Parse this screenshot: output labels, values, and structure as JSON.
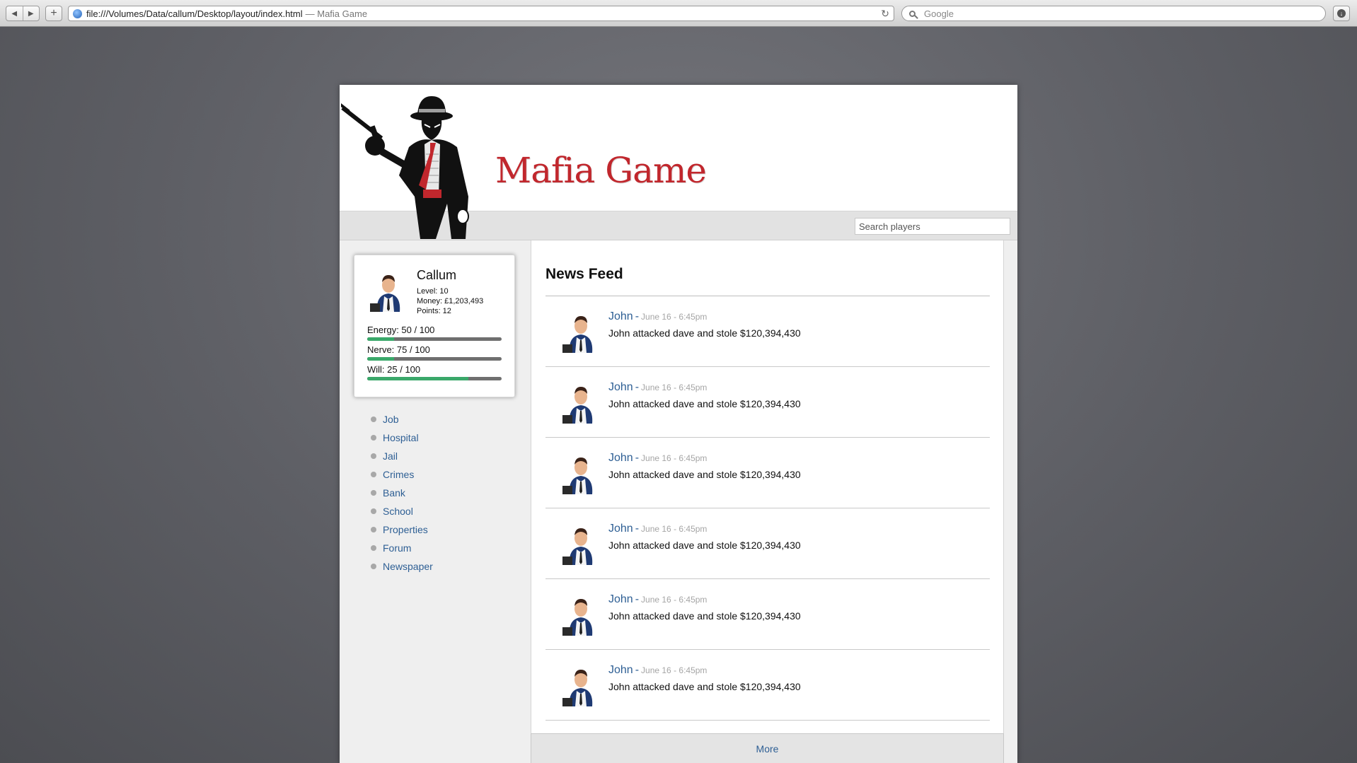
{
  "browser": {
    "url": "file:///Volumes/Data/callum/Desktop/layout/index.html",
    "title_suffix": "— Mafia Game",
    "search_placeholder": "Google"
  },
  "site": {
    "title": "Mafia Game",
    "search_placeholder": "Search players",
    "brand_color": "#c1272d",
    "link_color": "#2e5f94"
  },
  "profile": {
    "name": "Callum",
    "level": "Level: 10",
    "money": "Money: £1,203,493",
    "points": "Points: 12",
    "stats": [
      {
        "label": "Energy: 50 / 100",
        "fill": 0.2
      },
      {
        "label": "Nerve: 75 / 100",
        "fill": 0.2
      },
      {
        "label": "Will: 25 / 100",
        "fill": 0.75
      }
    ]
  },
  "nav": {
    "items": [
      "Job",
      "Hospital",
      "Jail",
      "Crimes",
      "Bank",
      "School",
      "Properties",
      "Forum",
      "Newspaper"
    ]
  },
  "feed": {
    "heading": "News Feed",
    "items": [
      {
        "author": "John",
        "sep": "-",
        "time": "June 16 - 6:45pm",
        "message": "John attacked dave and stole $120,394,430"
      },
      {
        "author": "John",
        "sep": "-",
        "time": "June 16 - 6:45pm",
        "message": "John attacked dave and stole $120,394,430"
      },
      {
        "author": "John",
        "sep": "-",
        "time": "June 16 - 6:45pm",
        "message": "John attacked dave and stole $120,394,430"
      },
      {
        "author": "John",
        "sep": "-",
        "time": "June 16 - 6:45pm",
        "message": "John attacked dave and stole $120,394,430"
      },
      {
        "author": "John",
        "sep": "-",
        "time": "June 16 - 6:45pm",
        "message": "John attacked dave and stole $120,394,430"
      },
      {
        "author": "John",
        "sep": "-",
        "time": "June 16 - 6:45pm",
        "message": "John attacked dave and stole $120,394,430"
      }
    ],
    "more_label": "More"
  }
}
